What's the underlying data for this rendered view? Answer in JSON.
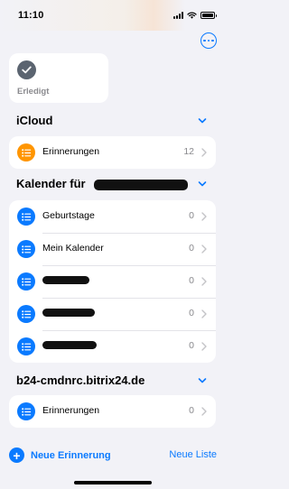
{
  "status_bar": {
    "time": "11:10"
  },
  "smart_lists": [
    {
      "label": "Erledigt",
      "icon": "checkmark-icon",
      "color": "#5b6470"
    }
  ],
  "accent_color": "#0a7aff",
  "sections": [
    {
      "title": "iCloud",
      "lists": [
        {
          "label": "Erinnerungen",
          "count": "12",
          "icon_color": "#ff9500"
        }
      ]
    },
    {
      "title": "Kalender für",
      "lists": [
        {
          "label": "Geburtstage",
          "count": "0",
          "icon_color": "#0a7aff"
        },
        {
          "label": "Mein Kalender",
          "count": "0",
          "icon_color": "#0a7aff"
        },
        {
          "label": "",
          "count": "0",
          "icon_color": "#0a7aff"
        },
        {
          "label": "",
          "count": "0",
          "icon_color": "#0a7aff"
        },
        {
          "label": "",
          "count": "0",
          "icon_color": "#0a7aff"
        }
      ]
    },
    {
      "title": "b24-cmdnrc.bitrix24.de",
      "lists": [
        {
          "label": "Erinnerungen",
          "count": "0",
          "icon_color": "#0a7aff"
        }
      ]
    }
  ],
  "toolbar": {
    "new_reminder": "Neue Erinnerung",
    "new_list": "Neue Liste"
  }
}
